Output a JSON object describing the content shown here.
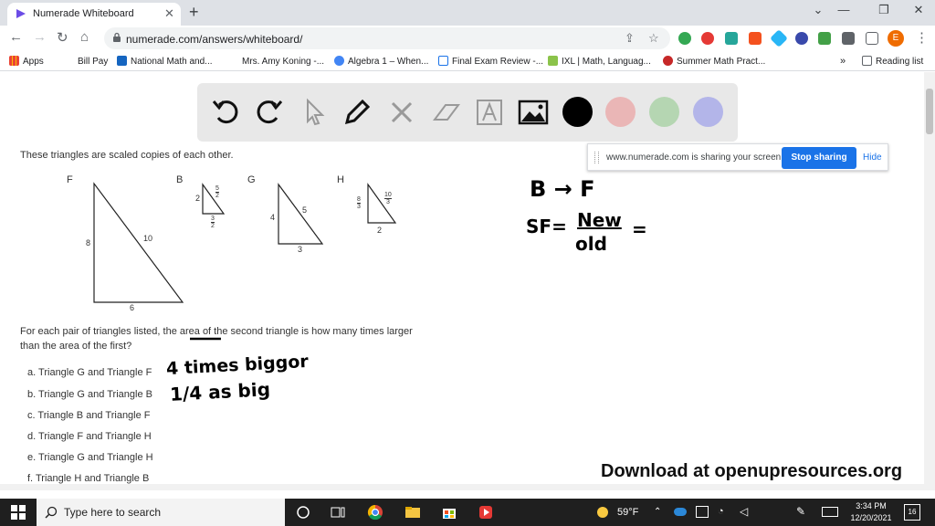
{
  "browser": {
    "tab_title": "Numerade Whiteboard",
    "url": "numerade.com/answers/whiteboard/",
    "bookmarks": [
      {
        "label": "Apps",
        "color": "#ea4335"
      },
      {
        "label": "Bill Pay",
        "color": "#ffffff"
      },
      {
        "label": "National Math and...",
        "color": "#1565c0"
      },
      {
        "label": "Mrs. Amy Koning -...",
        "color": "#ffffff"
      },
      {
        "label": "Algebra 1 – When...",
        "color": "#4285f4"
      },
      {
        "label": "Final Exam Review -...",
        "color": "#1a73e8"
      },
      {
        "label": "IXL | Math, Languag...",
        "color": "#8bc34a"
      },
      {
        "label": "Summer Math Pract...",
        "color": "#c62828"
      }
    ],
    "bookmarks_more": "»",
    "reading_list": "Reading list",
    "profile_initial": "E"
  },
  "share_bar": {
    "text": "www.numerade.com is sharing your screen.",
    "stop_label": "Stop sharing",
    "hide_label": "Hide"
  },
  "whiteboard": {
    "colors": [
      "#000000",
      "#eab6b6",
      "#b5d6b2",
      "#b3b5e9"
    ]
  },
  "problem": {
    "intro": "These triangles are scaled copies of each other.",
    "triangles": {
      "F": {
        "label": "F",
        "left": "8",
        "hyp": "10",
        "base": "6"
      },
      "B": {
        "label": "B",
        "left": "2",
        "hyp_num": "5",
        "hyp_den": "2",
        "base_num": "3",
        "base_den": "2"
      },
      "G": {
        "label": "G",
        "left": "4",
        "hyp": "5",
        "base": "3"
      },
      "H": {
        "label": "H",
        "left_num": "8",
        "left_den": "3",
        "hyp_num": "10",
        "hyp_den": "3",
        "base": "2"
      }
    },
    "question_line1": "For each pair of triangles listed, the area of the second triangle is how many times larger",
    "question_line2": "than the area of the first?",
    "items": [
      "a. Triangle G and Triangle F",
      "b. Triangle G and Triangle B",
      "c. Triangle B and Triangle F",
      "d. Triangle F and Triangle H",
      "e. Triangle G and Triangle H",
      "f. Triangle H and Triangle B"
    ]
  },
  "handwriting": {
    "line1": "B → F",
    "sf": "SF=",
    "new": "New",
    "old": "old",
    "eq": "=",
    "answer_a": "4 times biggor",
    "answer_b": "1/4 as big"
  },
  "watermark": "Download at openupresources.org",
  "taskbar": {
    "search_placeholder": "Type here to search",
    "weather": "59°F",
    "time": "3:34 PM",
    "date": "12/20/2021",
    "notifications": "16"
  }
}
